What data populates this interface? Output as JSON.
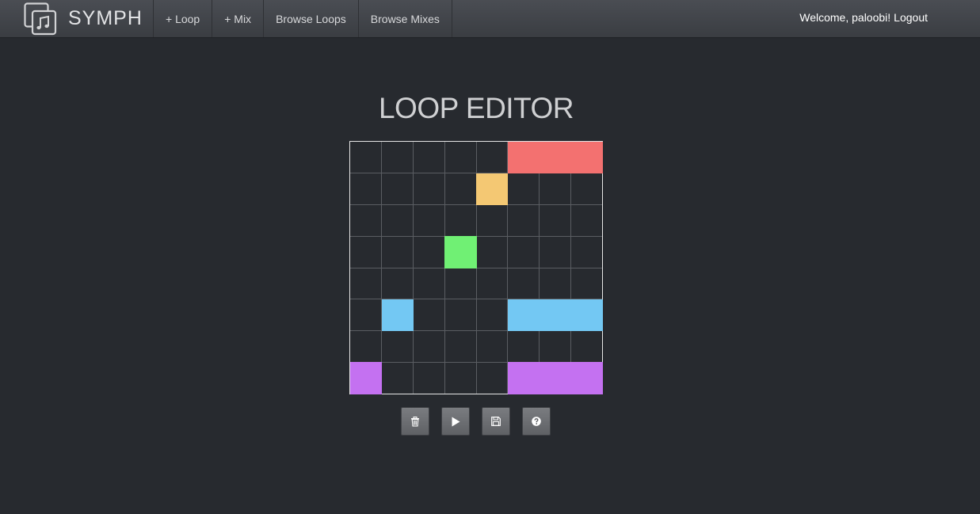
{
  "app": {
    "name": "SYMPH"
  },
  "nav": {
    "links": [
      {
        "label": "+ Loop"
      },
      {
        "label": "+ Mix"
      },
      {
        "label": "Browse Loops"
      },
      {
        "label": "Browse Mixes"
      }
    ],
    "welcome": "Welcome, paloobi!",
    "logout": "Logout"
  },
  "editor": {
    "title": "LOOP EDITOR",
    "rows": 8,
    "cols": 8,
    "active_cells": [
      {
        "row": 0,
        "col": 5,
        "color": "#f37170"
      },
      {
        "row": 0,
        "col": 6,
        "color": "#f37170"
      },
      {
        "row": 0,
        "col": 7,
        "color": "#f37170"
      },
      {
        "row": 1,
        "col": 4,
        "color": "#f4c873"
      },
      {
        "row": 3,
        "col": 3,
        "color": "#70f074"
      },
      {
        "row": 5,
        "col": 1,
        "color": "#73c8f3"
      },
      {
        "row": 5,
        "col": 5,
        "color": "#73c8f3"
      },
      {
        "row": 5,
        "col": 6,
        "color": "#73c8f3"
      },
      {
        "row": 5,
        "col": 7,
        "color": "#73c8f3"
      },
      {
        "row": 7,
        "col": 0,
        "color": "#c471f1"
      },
      {
        "row": 7,
        "col": 5,
        "color": "#c471f1"
      },
      {
        "row": 7,
        "col": 6,
        "color": "#c471f1"
      },
      {
        "row": 7,
        "col": 7,
        "color": "#c471f1"
      }
    ],
    "controls": [
      {
        "icon": "trash-icon"
      },
      {
        "icon": "play-icon"
      },
      {
        "icon": "save-icon"
      },
      {
        "icon": "help-icon"
      }
    ]
  },
  "colors": {
    "background": "#272a2f",
    "grid_line": "#5a5d62",
    "grid_border": "#e6e6e6"
  }
}
